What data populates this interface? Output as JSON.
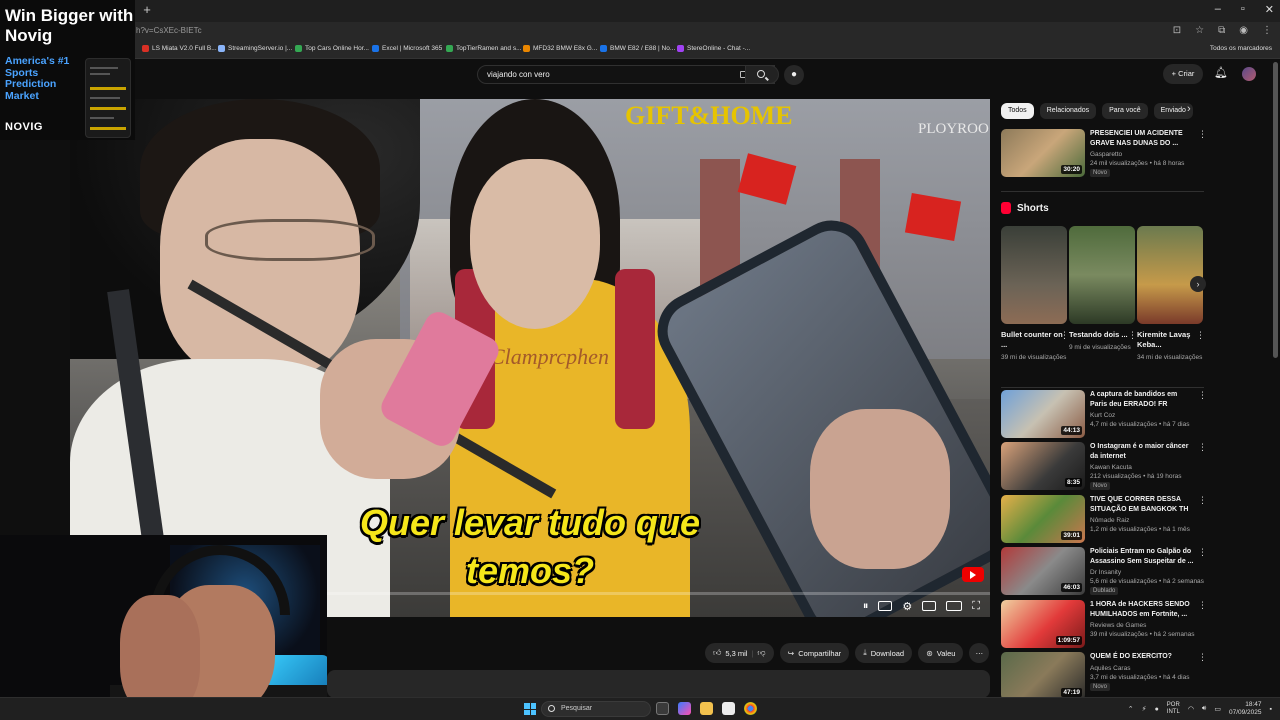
{
  "browser": {
    "url": "h?v=CsXEc-BIETc",
    "bookmarks": [
      {
        "label": "LS Miata V2.0 Full B...",
        "color": "#d93025"
      },
      {
        "label": "StreamingServer.io |...",
        "color": "#8ab4f8"
      },
      {
        "label": "Top Cars Online Hor...",
        "color": "#34a853"
      },
      {
        "label": "Excel | Microsoft 365",
        "color": "#1a73e8"
      },
      {
        "label": "TopTierRamen and s...",
        "color": "#34a853"
      },
      {
        "label": "MFD32 BMW E8x G...",
        "color": "#ea8600"
      },
      {
        "label": "BMW E82 / E88 | No...",
        "color": "#1a73e8"
      },
      {
        "label": "StereOnline - Chat -...",
        "color": "#a142f4"
      }
    ],
    "all_bookmarks": "Todos os marcadores"
  },
  "ad": {
    "title": "Win Bigger with Novig",
    "subtitle": "America's #1 Sports Prediction Market",
    "brand": "NOVIG"
  },
  "header": {
    "search_value": "viajando con vero",
    "create_label": "Criar"
  },
  "video": {
    "store_sign": "GIFT&HOME",
    "store_sign2": "PLOYROO",
    "shirt_text": "Clamprcphen",
    "subtitle_line1": "Quer levar tudo que",
    "subtitle_line2": "temos?",
    "progress": 0.07
  },
  "actions": {
    "likes": "5,3 mil",
    "share": "Compartilhar",
    "download": "Download",
    "thanks": "Valeu"
  },
  "sidebar": {
    "chips": [
      "Todos",
      "Relacionados",
      "Para você",
      "Enviado"
    ],
    "shorts_label": "Shorts",
    "top": {
      "title": "PRESENCIEI UM ACIDENTE GRAVE NAS DUNAS DO ...",
      "channel": "Gasparetto",
      "meta": "24 mil visualizações • há 8 horas",
      "badge": "Novo",
      "duration": "30:20"
    },
    "shorts": [
      {
        "title": "Bullet counter on ...",
        "views": "39 mi de visualizações"
      },
      {
        "title": "Testando dois ...",
        "views": "9 mi de visualizações"
      },
      {
        "title": "Kiremite Lavaş Keba...",
        "views": "34 mi de visualizações"
      }
    ],
    "videos": [
      {
        "title": "A captura de bandidos em Paris deu ERRADO! FR",
        "channel": "Kurt Coz",
        "meta": "4,7 mi de visualizações • há 7 dias",
        "duration": "44:13",
        "badge": ""
      },
      {
        "title": "O Instagram é o maior câncer da internet",
        "channel": "Kawan Kacuta",
        "meta": "212 visualizações • há 19 horas",
        "duration": "8:35",
        "badge": "Novo"
      },
      {
        "title": "TIVE QUE CORRER DESSA SITUAÇÃO EM BANGKOK TH",
        "channel": "Nômade Raiz",
        "meta": "1,2 mi de visualizações • há 1 mês",
        "duration": "39:01",
        "badge": ""
      },
      {
        "title": "Policiais Entram no Galpão do Assassino Sem Suspeitar de ...",
        "channel": "Dr Insanity",
        "meta": "5,6 mi de visualizações • há 2 semanas",
        "duration": "46:03",
        "badge": "Dublado"
      },
      {
        "title": "1 HORA de HACKERS SENDO HUMILHADOS em Fortnite, ...",
        "channel": "Reviews de Games",
        "meta": "39 mil visualizações • há 2 semanas",
        "duration": "1:09:57",
        "badge": ""
      },
      {
        "title": "QUEM É DO EXERCITO?",
        "channel": "Aquiles Caras",
        "meta": "3,7 mi de visualizações • há 4 dias",
        "duration": "47:19",
        "badge": "Novo"
      }
    ]
  },
  "taskbar": {
    "search_placeholder": "Pesquisar",
    "lang_top": "POR",
    "lang_bottom": "INTL",
    "time": "18:47",
    "date": "07/09/2025"
  }
}
